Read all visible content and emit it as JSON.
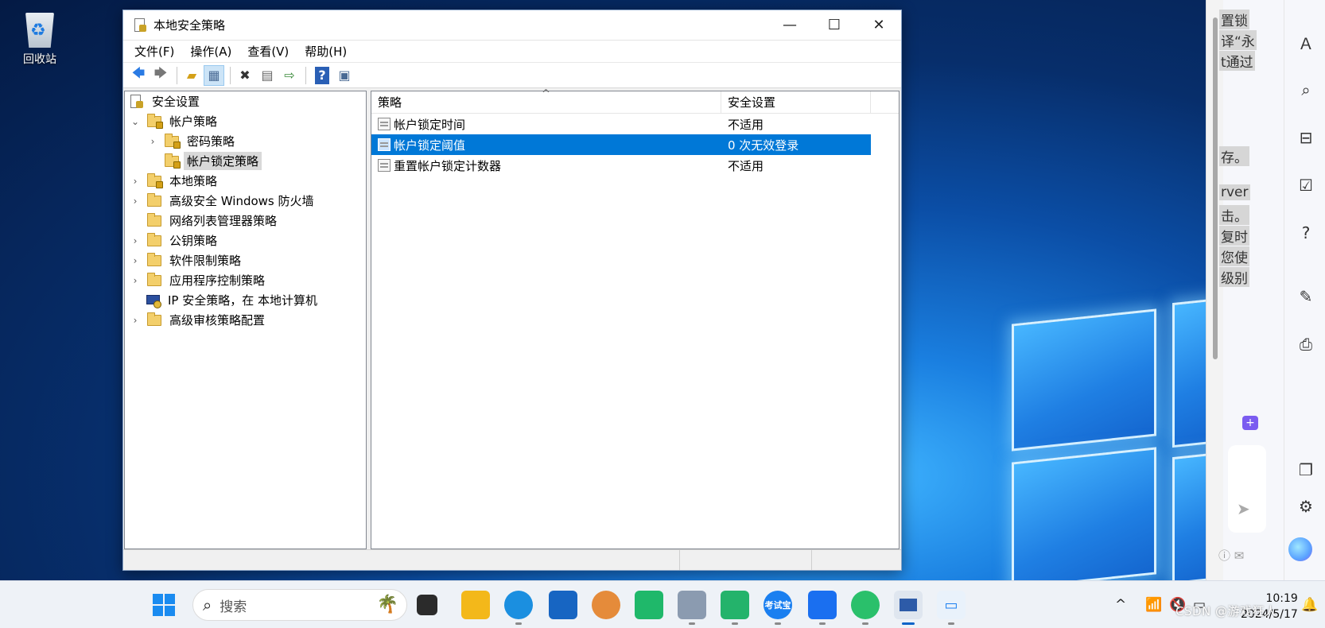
{
  "desktop": {
    "recycle_bin_label": "回收站"
  },
  "window": {
    "title": "本地安全策略",
    "controls": {
      "minimize": "—",
      "maximize": "☐",
      "close": "✕"
    },
    "menu": [
      "文件(F)",
      "操作(A)",
      "查看(V)",
      "帮助(H)"
    ]
  },
  "tree": {
    "root": "安全设置",
    "account_policy": "帐户策略",
    "password_policy": "密码策略",
    "lockout_policy": "帐户锁定策略",
    "local_policy": "本地策略",
    "firewall": "高级安全 Windows 防火墙",
    "network_list": "网络列表管理器策略",
    "public_key": "公钥策略",
    "software_restriction": "软件限制策略",
    "app_control": "应用程序控制策略",
    "ipsec": "IP 安全策略，在 本地计算机",
    "audit": "高级审核策略配置"
  },
  "list": {
    "columns": [
      "策略",
      "安全设置"
    ],
    "rows": [
      {
        "policy": "帐户锁定时间",
        "setting": "不适用"
      },
      {
        "policy": "帐户锁定阈值",
        "setting": "0 次无效登录"
      },
      {
        "policy": "重置帐户锁定计数器",
        "setting": "不适用"
      }
    ]
  },
  "side_panel": {
    "snippets": [
      "置锁",
      "译“永",
      "t通过",
      "存。",
      "rver",
      "击。",
      "复时",
      "您使",
      "级别"
    ]
  },
  "taskbar": {
    "search_placeholder": "搜索",
    "kaoshi_label": "考试宝",
    "time": "10:19",
    "date": "2024/5/17"
  },
  "watermark": "CSDN @游戏狂人"
}
